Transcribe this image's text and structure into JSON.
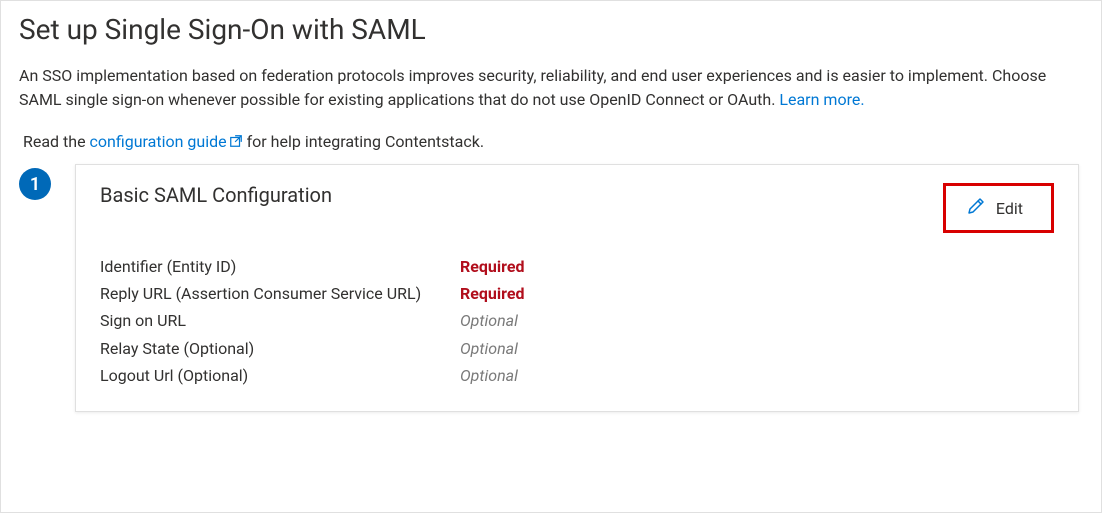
{
  "header": {
    "title": "Set up Single Sign-On with SAML"
  },
  "intro": {
    "text_before_link": "An SSO implementation based on federation protocols improves security, reliability, and end user experiences and is easier to implement. Choose SAML single sign-on whenever possible for existing applications that do not use OpenID Connect or OAuth. ",
    "learn_more": "Learn more."
  },
  "guide": {
    "prefix": "Read the ",
    "link_text": "configuration guide",
    "suffix": " for help integrating Contentstack."
  },
  "step": {
    "number": "1",
    "card": {
      "title": "Basic SAML Configuration",
      "edit_label": "Edit",
      "rows": [
        {
          "label": "Identifier (Entity ID)",
          "value": "Required",
          "status": "required"
        },
        {
          "label": "Reply URL (Assertion Consumer Service URL)",
          "value": "Required",
          "status": "required"
        },
        {
          "label": "Sign on URL",
          "value": "Optional",
          "status": "optional"
        },
        {
          "label": "Relay State (Optional)",
          "value": "Optional",
          "status": "optional"
        },
        {
          "label": "Logout Url (Optional)",
          "value": "Optional",
          "status": "optional"
        }
      ]
    }
  }
}
